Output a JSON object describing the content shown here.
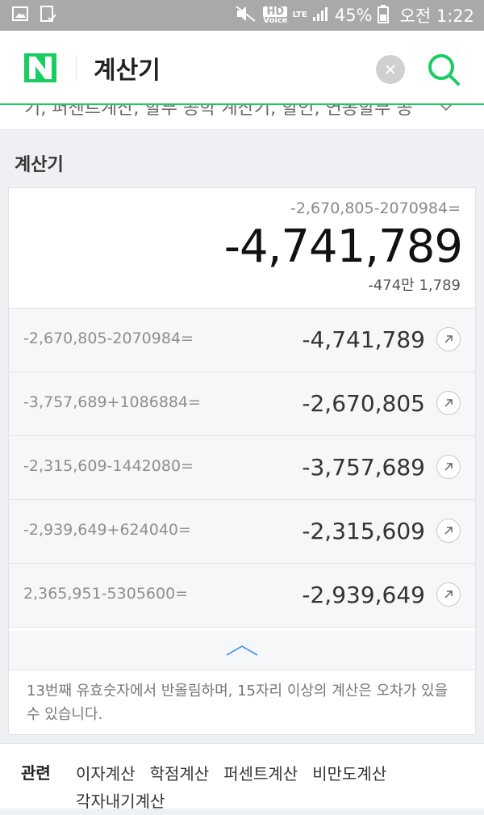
{
  "status_bar": {
    "hd": "HD",
    "voice": "Voice",
    "lte": "LTE",
    "battery": "45%",
    "time": "오전 1:22"
  },
  "header": {
    "query": "계산기"
  },
  "suggest": {
    "text": "기, 퍼센트계산, 할부 공학 계산기, 할인, 연봉할부 공"
  },
  "section": {
    "title": "계산기"
  },
  "calculator": {
    "expression": "-2,670,805-2070984=",
    "result": "-4,741,789",
    "korean_reading": "-474만 1,789",
    "history": [
      {
        "expression": "-2,670,805-2070984=",
        "result": "-4,741,789"
      },
      {
        "expression": "-3,757,689+1086884=",
        "result": "-2,670,805"
      },
      {
        "expression": "-2,315,609-1442080=",
        "result": "-3,757,689"
      },
      {
        "expression": "-2,939,649+624040=",
        "result": "-2,315,609"
      },
      {
        "expression": "2,365,951-5305600=",
        "result": "-2,939,649"
      }
    ],
    "notice": "13번째 유효숫자에서 반올림하며, 15자리 이상의 계산은 오차가 있을 수 있습니다."
  },
  "related": {
    "label": "관련",
    "links": [
      "이자계산",
      "학점계산",
      "퍼센트계산",
      "비만도계산",
      "각자내기계산"
    ]
  },
  "colors": {
    "naver_green": "#19ce60",
    "status_bar": "#a9a9a9"
  }
}
